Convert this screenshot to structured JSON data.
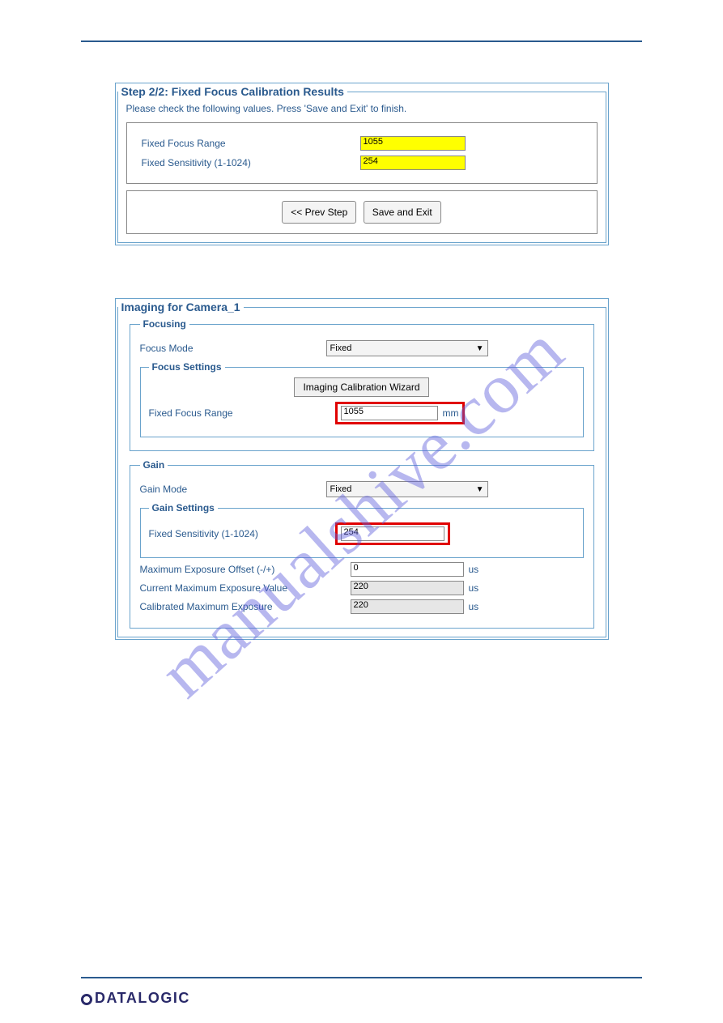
{
  "panel1": {
    "legend": "Step 2/2: Fixed Focus Calibration Results",
    "instruction": "Please check the following values. Press 'Save and Exit' to finish.",
    "rows": [
      {
        "label": "Fixed Focus Range",
        "value": "1055"
      },
      {
        "label": "Fixed Sensitivity (1-1024)",
        "value": "254"
      }
    ],
    "buttons": {
      "prev": "<< Prev Step",
      "save": "Save and Exit"
    }
  },
  "panel2": {
    "legend": "Imaging for Camera_1",
    "focusing": {
      "legend": "Focusing",
      "mode_label": "Focus Mode",
      "mode_value": "Fixed",
      "settings": {
        "legend": "Focus Settings",
        "wizard_btn": "Imaging Calibration Wizard",
        "range_label": "Fixed Focus Range",
        "range_value": "1055",
        "range_unit": "mm"
      }
    },
    "gain": {
      "legend": "Gain",
      "mode_label": "Gain Mode",
      "mode_value": "Fixed",
      "settings": {
        "legend": "Gain Settings",
        "sens_label": "Fixed Sensitivity (1-1024)",
        "sens_value": "254"
      },
      "rows": [
        {
          "label": "Maximum Exposure Offset (-/+)",
          "value": "0",
          "unit": "us",
          "readonly": false
        },
        {
          "label": "Current Maximum Exposure Value",
          "value": "220",
          "unit": "us",
          "readonly": true
        },
        {
          "label": "Calibrated Maximum Exposure",
          "value": "220",
          "unit": "us",
          "readonly": true
        }
      ]
    }
  },
  "watermark": "manualshive.com",
  "footer": {
    "brand": "DATALOGIC"
  }
}
